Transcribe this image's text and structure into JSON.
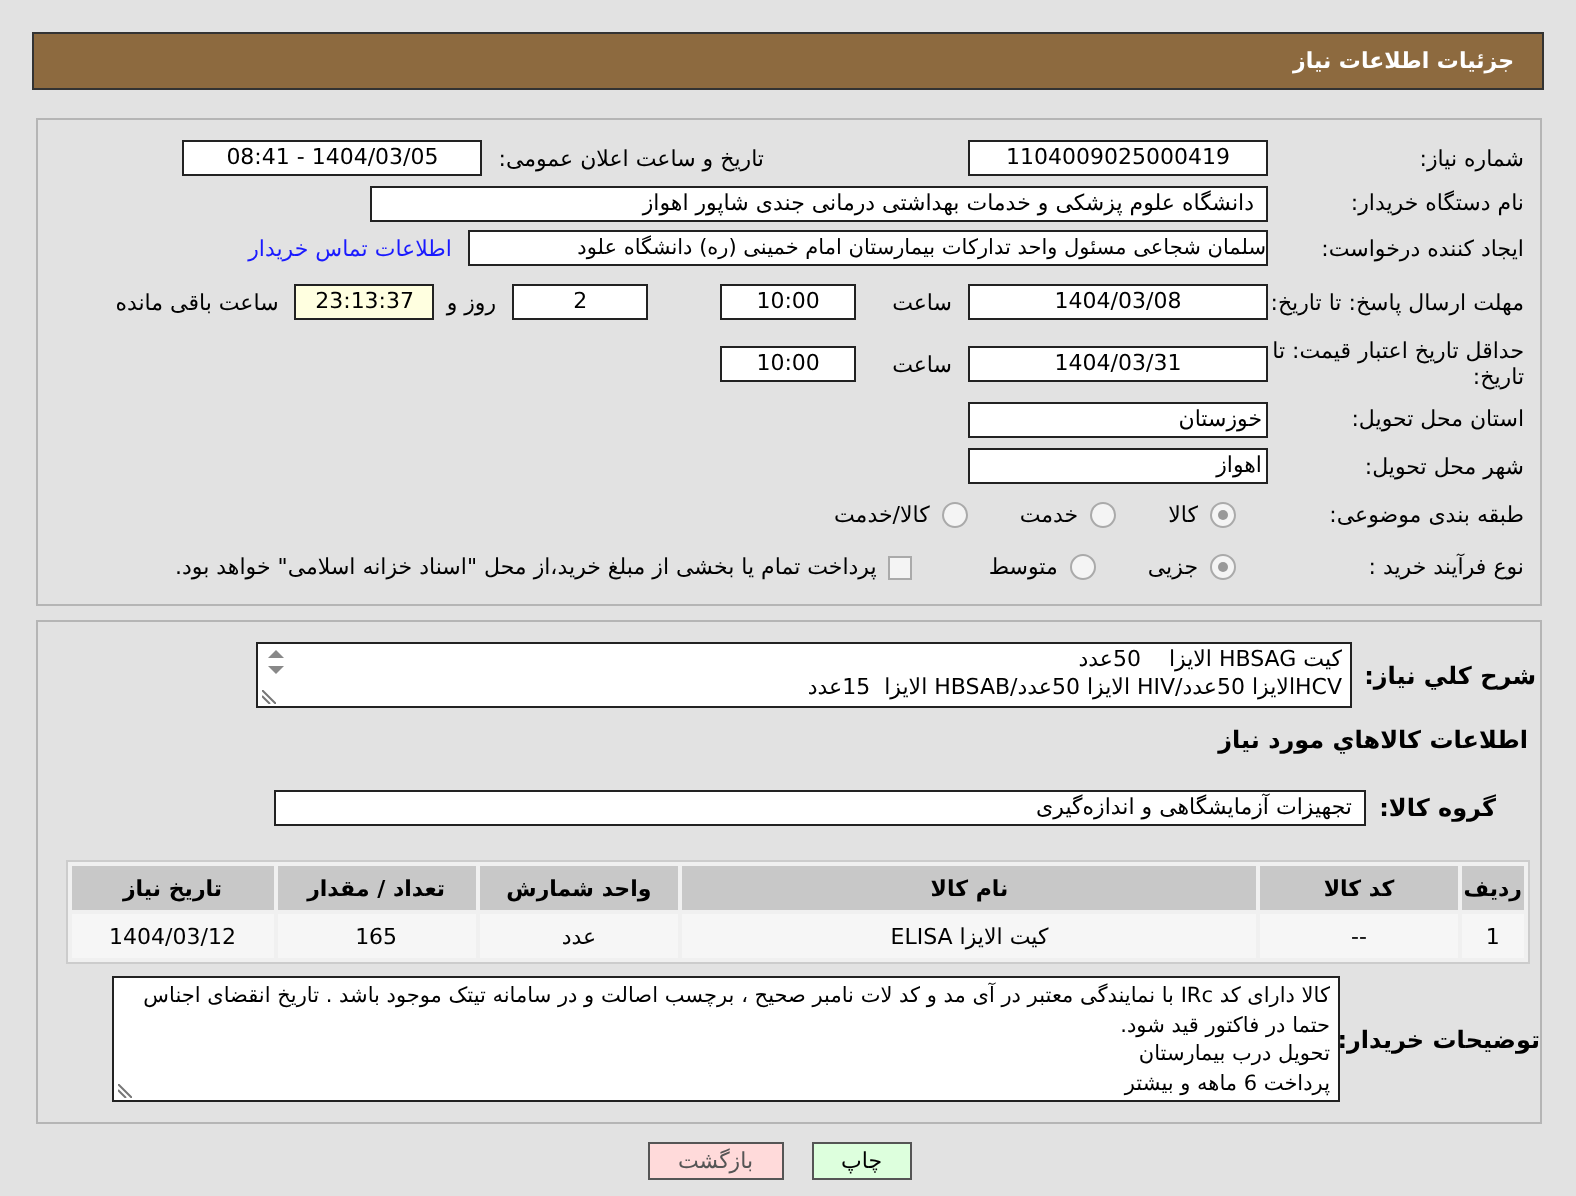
{
  "header": {
    "title": "جزئیات اطلاعات نیاز"
  },
  "need_number": {
    "label": "شماره نیاز:",
    "value": "1104009025000419"
  },
  "announce": {
    "label": "تاریخ و ساعت اعلان عمومی:",
    "value": "1404/03/05 - 08:41"
  },
  "buyer_org": {
    "label": "نام دستگاه خریدار:",
    "value": "دانشگاه علوم پزشکی و خدمات بهداشتی درمانی جندی شاپور اهواز"
  },
  "requester": {
    "label": "ایجاد کننده درخواست:",
    "value": "سلمان شجاعی مسئول واحد تدارکات بیمارستان امام خمینی (ره) دانشگاه علود",
    "link": "اطلاعات تماس خریدار"
  },
  "reply_deadline": {
    "label": "مهلت ارسال پاسخ: تا تاریخ:",
    "date": "1404/03/08",
    "time_label": "ساعت",
    "time": "10:00",
    "days": "2",
    "days_label": "روز و",
    "remaining": "23:13:37",
    "remaining_label": "ساعت باقی مانده"
  },
  "price_validity": {
    "label": "حداقل تاریخ اعتبار قیمت: تا تاریخ:",
    "date": "1404/03/31",
    "time_label": "ساعت",
    "time": "10:00"
  },
  "province": {
    "label": "استان محل تحویل:",
    "value": "خوزستان"
  },
  "city": {
    "label": "شهر محل تحویل:",
    "value": "اهواز"
  },
  "category": {
    "label": "طبقه بندی موضوعی:",
    "options": [
      {
        "label": "کالا",
        "selected": true
      },
      {
        "label": "خدمت",
        "selected": false
      },
      {
        "label": "کالا/خدمت",
        "selected": false
      }
    ]
  },
  "process": {
    "label": "نوع فرآیند خرید :",
    "options": [
      {
        "label": "جزیی",
        "selected": true
      },
      {
        "label": "متوسط",
        "selected": false
      }
    ],
    "treasury": {
      "label": "پرداخت تمام یا بخشی از مبلغ خرید،از محل \"اسناد خزانه اسلامی\" خواهد بود.",
      "checked": false
    }
  },
  "summary": {
    "label": "شرح کلي نياز:",
    "lines": [
      "کیت HBSAG الایزا    50عدد",
      "HCVالایزا 50عدد/HIV الایزا 50عدد/HBSAB الایزا  15عدد"
    ]
  },
  "items_title": "اطلاعات کالاهاي مورد نياز",
  "group": {
    "label": "گروه کالا:",
    "value": "تجهیزات آزمایشگاهی و اندازه‌گیری"
  },
  "table": {
    "columns": [
      "ردیف",
      "کد کالا",
      "نام کالا",
      "واحد شمارش",
      "تعداد / مقدار",
      "تاریخ نیاز"
    ],
    "rows": [
      [
        "1",
        "--",
        "کیت الایزا ELISA",
        "عدد",
        "165",
        "1404/03/12"
      ]
    ]
  },
  "buyer_notes": {
    "label": "توضیحات خریدار:",
    "lines": [
      "کالا دارای کد IRc با نمایندگی معتبر در آی مد و کد لات نامبر صحیح ، برچسب اصالت و در سامانه تیتک موجود باشد . تاریخ انقضای اجناس حتما در فاکتور قید شود.",
      "تحویل درب بیمارستان",
      "پرداخت 6 ماهه و بیشتر"
    ]
  },
  "buttons": [
    {
      "label": "چاپ",
      "kind": "print"
    },
    {
      "label": "بازگشت",
      "kind": "back"
    }
  ]
}
